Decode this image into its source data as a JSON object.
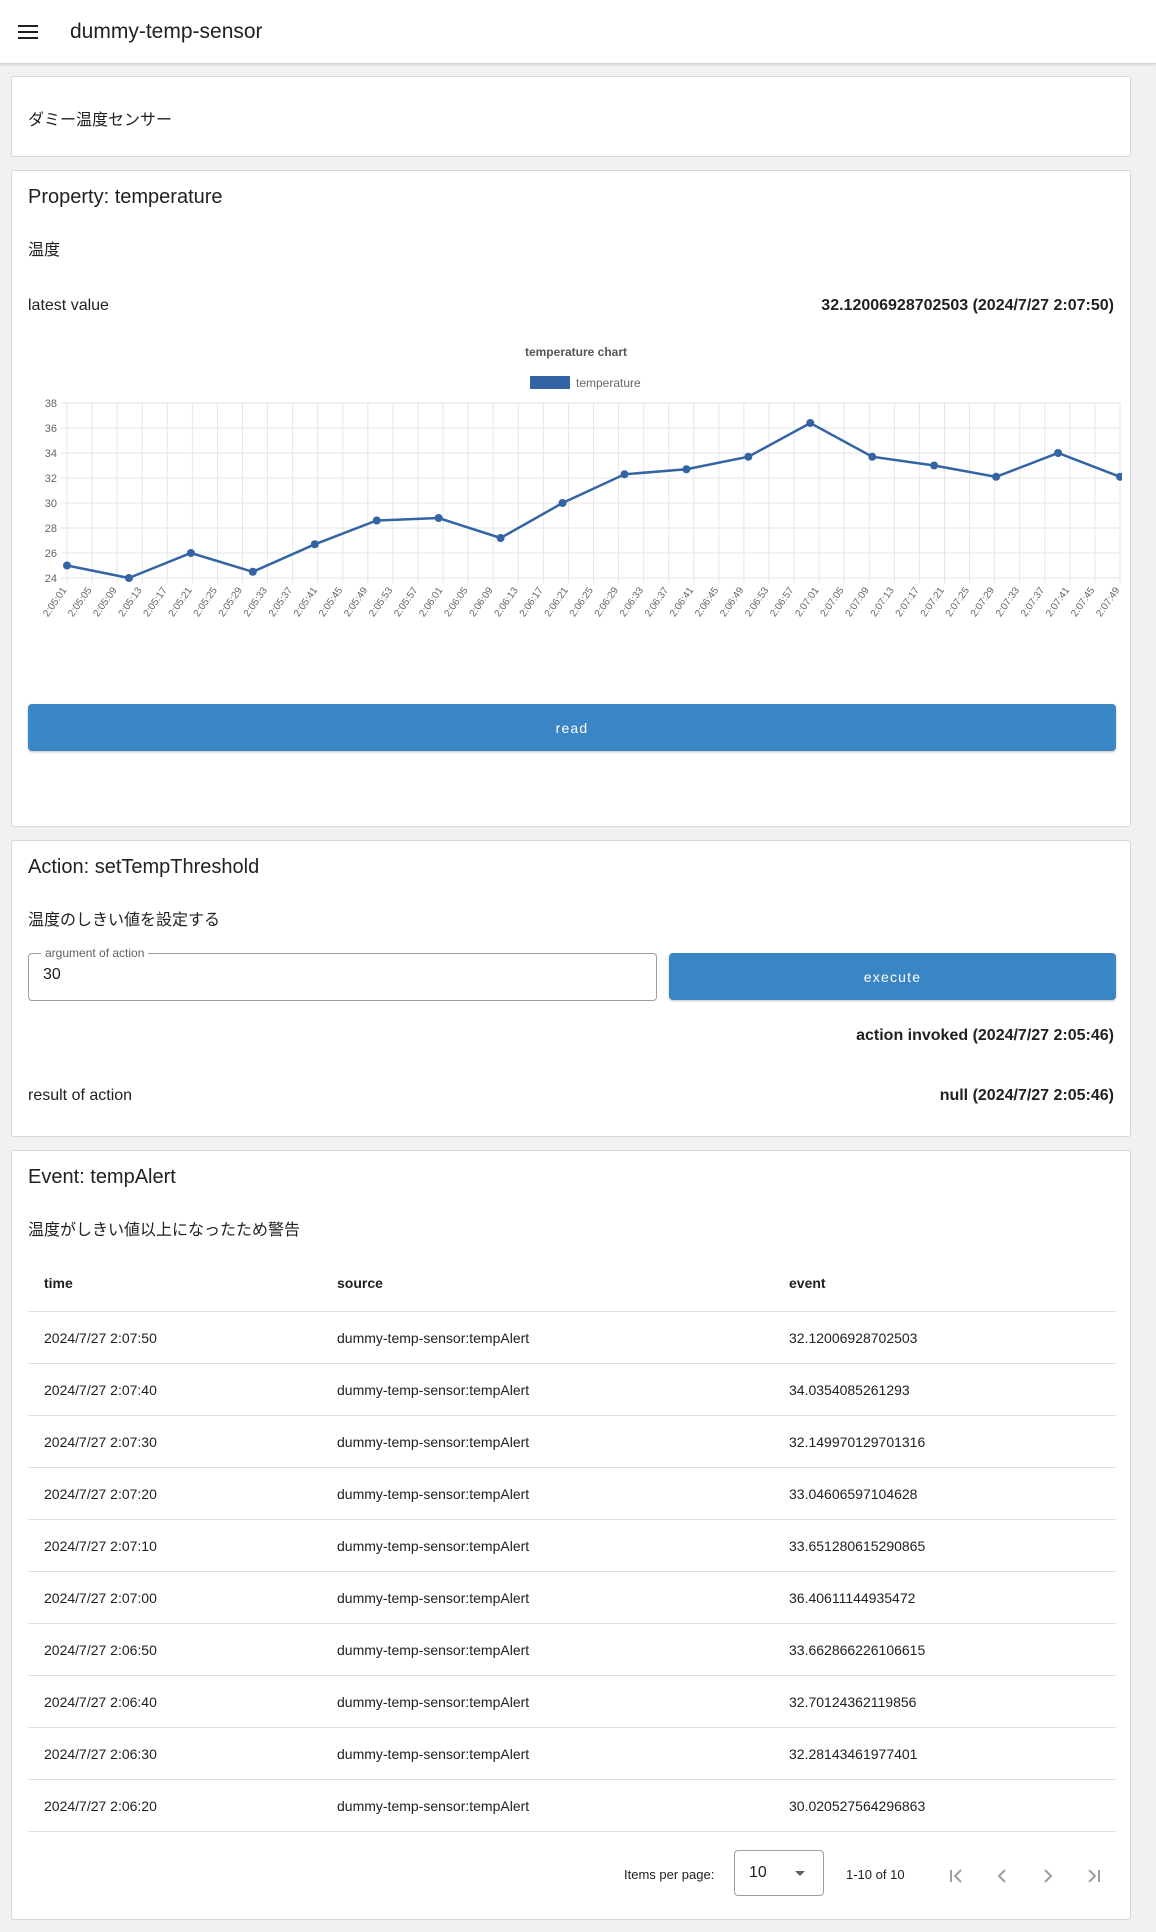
{
  "app": {
    "title": "dummy-temp-sensor"
  },
  "thing": {
    "description": "ダミー温度センサー"
  },
  "property": {
    "title": "Property: temperature",
    "description": "温度",
    "latest_label": "latest value",
    "latest_value": "32.12006928702503 (2024/7/27 2:07:50)",
    "read_label": "read"
  },
  "chart_data": {
    "type": "line",
    "title": "temperature chart",
    "legend": "top-center",
    "grid": true,
    "series": [
      {
        "name": "temperature",
        "color": "#3464a4",
        "points": [
          [
            "2:05:01",
            25.0
          ],
          [
            "2:05:13",
            24.0
          ],
          [
            "2:05:25",
            26.0
          ],
          [
            "2:05:37",
            24.5
          ],
          [
            "2:05:49",
            26.7
          ],
          [
            "2:06:01",
            28.6
          ],
          [
            "2:06:13",
            28.8
          ],
          [
            "2:06:25",
            27.2
          ],
          [
            "2:06:37",
            30.0
          ],
          [
            "2:06:49",
            32.3
          ],
          [
            "2:07:01",
            32.7
          ],
          [
            "2:07:13",
            33.7
          ],
          [
            "2:07:25",
            36.4
          ],
          [
            "2:07:37",
            33.7
          ],
          [
            "2:07:49",
            33.0
          ],
          [
            "2:08:01",
            32.1
          ],
          [
            "2:08:13",
            34.0
          ],
          [
            "2:08:25",
            32.1
          ]
        ]
      }
    ],
    "x_ticks": [
      "2:05:01",
      "2:05:05",
      "2:05:09",
      "2:05:13",
      "2:05:17",
      "2:05:21",
      "2:05:25",
      "2:05:29",
      "2:05:33",
      "2:05:37",
      "2:05:41",
      "2:05:45",
      "2:05:49",
      "2:05:53",
      "2:05:57",
      "2:06:01",
      "2:06:05",
      "2:06:09",
      "2:06:13",
      "2:06:17",
      "2:06:21",
      "2:06:25",
      "2:06:29",
      "2:06:33",
      "2:06:37",
      "2:06:41",
      "2:06:45",
      "2:06:49",
      "2:06:53",
      "2:06:57",
      "2:07:01",
      "2:07:05",
      "2:07:09",
      "2:07:13",
      "2:07:17",
      "2:07:21",
      "2:07:25",
      "2:07:29",
      "2:07:33",
      "2:07:37",
      "2:07:41",
      "2:07:45",
      "2:07:49"
    ],
    "y_ticks": [
      24,
      26,
      28,
      30,
      32,
      34,
      36,
      38
    ],
    "ylim": [
      24,
      38
    ]
  },
  "action": {
    "title": "Action: setTempThreshold",
    "description": "温度のしきい値を設定する",
    "arg_label": "argument of action",
    "arg_value": "30",
    "execute_label": "execute",
    "status": "action invoked (2024/7/27 2:05:46)",
    "result_label": "result of action",
    "result_value": "null (2024/7/27 2:05:46)"
  },
  "event": {
    "title": "Event: tempAlert",
    "description": "温度がしきい値以上になったため警告",
    "columns": [
      "time",
      "source",
      "event"
    ],
    "rows": [
      [
        "2024/7/27 2:07:50",
        "dummy-temp-sensor:tempAlert",
        "32.12006928702503"
      ],
      [
        "2024/7/27 2:07:40",
        "dummy-temp-sensor:tempAlert",
        "34.0354085261293"
      ],
      [
        "2024/7/27 2:07:30",
        "dummy-temp-sensor:tempAlert",
        "32.149970129701316"
      ],
      [
        "2024/7/27 2:07:20",
        "dummy-temp-sensor:tempAlert",
        "33.04606597104628"
      ],
      [
        "2024/7/27 2:07:10",
        "dummy-temp-sensor:tempAlert",
        "33.651280615290865"
      ],
      [
        "2024/7/27 2:07:00",
        "dummy-temp-sensor:tempAlert",
        "36.40611144935472"
      ],
      [
        "2024/7/27 2:06:50",
        "dummy-temp-sensor:tempAlert",
        "33.662866226106615"
      ],
      [
        "2024/7/27 2:06:40",
        "dummy-temp-sensor:tempAlert",
        "32.70124362119856"
      ],
      [
        "2024/7/27 2:06:30",
        "dummy-temp-sensor:tempAlert",
        "32.28143461977401"
      ],
      [
        "2024/7/27 2:06:20",
        "dummy-temp-sensor:tempAlert",
        "30.020527564296863"
      ]
    ],
    "paginator": {
      "items_per_page_label": "Items per page:",
      "items_per_page": "10",
      "range": "1-10 of 10"
    }
  },
  "icons": {
    "menu": "menu-icon",
    "first_page": "first-page-icon",
    "prev_page": "chevron-left-icon",
    "next_page": "chevron-right-icon",
    "last_page": "last-page-icon"
  }
}
